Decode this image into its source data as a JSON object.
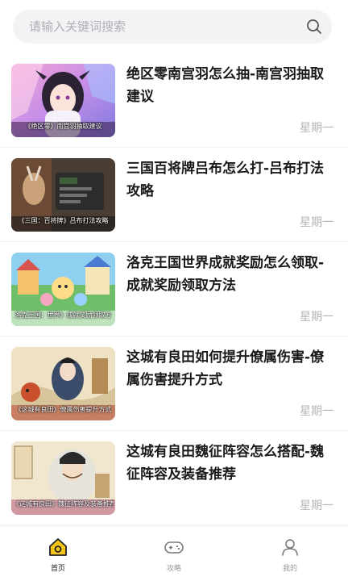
{
  "search": {
    "placeholder": "请输入关键词搜索",
    "value": ""
  },
  "articles": [
    {
      "title": "绝区零南宫羽怎么抽-南宫羽抽取建议",
      "date": "星期一",
      "thumb_caption": "《绝区零》南宫羽抽取建议",
      "thumb_icon": "anime-girl-thumbnail"
    },
    {
      "title": "三国百将牌吕布怎么打-吕布打法攻略",
      "date": "星期一",
      "thumb_caption": "《三国：百将牌》吕布打法攻略",
      "thumb_icon": "dark-game-screenshot-thumbnail"
    },
    {
      "title": "洛克王国世界成就奖励怎么领取-成就奖励领取方法",
      "date": "星期一",
      "thumb_caption": "洛克王国：世界》成就奖励领取方",
      "thumb_icon": "colorful-town-thumbnail"
    },
    {
      "title": "这城有良田如何提升僚属伤害-僚属伤害提升方式",
      "date": "星期一",
      "thumb_caption": "《这城有良田》僚属伤害提升方式",
      "thumb_icon": "ink-painting-thumbnail"
    },
    {
      "title": "这城有良田魏征阵容怎么搭配-魏征阵容及装备推荐",
      "date": "星期一",
      "thumb_caption": "《这城有良田》魏征阵容及装备推荐",
      "thumb_icon": "scholar-portrait-thumbnail"
    }
  ],
  "tabs": [
    {
      "label": "首页",
      "icon": "home-icon",
      "active": true
    },
    {
      "label": "攻略",
      "icon": "gamepad-icon",
      "active": false
    },
    {
      "label": "我的",
      "icon": "user-icon",
      "active": false
    }
  ],
  "colors": {
    "accent": "#f5c518",
    "date_text": "#b5b5b5",
    "search_bg": "#f3f3f5"
  }
}
